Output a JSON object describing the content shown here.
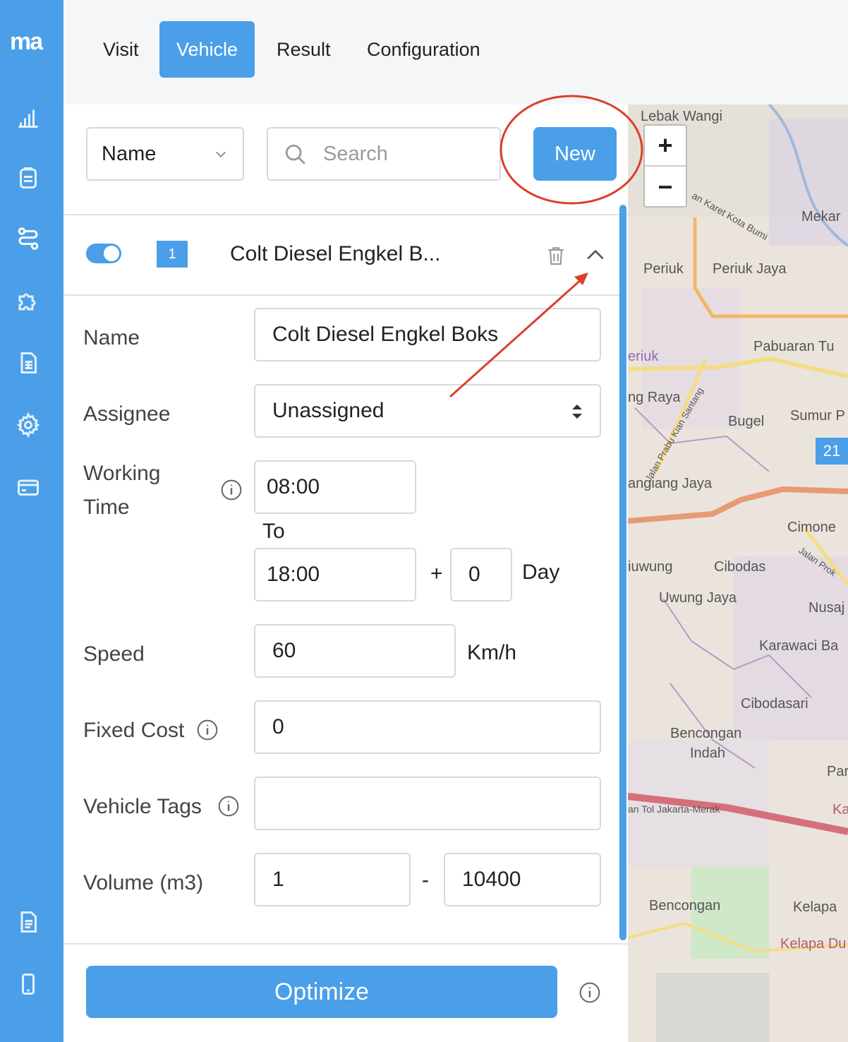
{
  "app": {
    "logo": "ma"
  },
  "tabs": [
    {
      "label": "Visit"
    },
    {
      "label": "Vehicle"
    },
    {
      "label": "Result"
    },
    {
      "label": "Configuration"
    }
  ],
  "toolbar": {
    "sort_select": "Name",
    "search_placeholder": "Search",
    "new_label": "New"
  },
  "vehicle": {
    "index": "1",
    "title": "Colt Diesel Engkel B...",
    "form": {
      "name_label": "Name",
      "name_value": "Colt Diesel Engkel Boks",
      "assignee_label": "Assignee",
      "assignee_value": "Unassigned",
      "working_time_label_1": "Working",
      "working_time_label_2": "Time",
      "start_time": "08:00",
      "to_label": "To",
      "end_time": "18:00",
      "plus": "+",
      "day_offset": "0",
      "day_label": "Day",
      "speed_label": "Speed",
      "speed_value": "60",
      "speed_unit": "Km/h",
      "fixed_cost_label": "Fixed Cost",
      "fixed_cost_value": "0",
      "tags_label": "Vehicle Tags",
      "tags_value": "",
      "volume_label": "Volume (m3)",
      "volume_min": "1",
      "volume_sep": "-",
      "volume_max": "10400"
    }
  },
  "footer": {
    "optimize_label": "Optimize"
  },
  "map": {
    "zoom_in": "+",
    "zoom_out": "−",
    "cluster_count": "21",
    "labels": [
      "Lebak Wangi",
      "Mekar",
      "Periuk",
      "Periuk Jaya",
      "Pabuaran Tu",
      "eriuk",
      "ng Raya",
      "Bugel",
      "Sumur P",
      "angiang Jaya",
      "Cimone",
      "iuwung",
      "Cibodas",
      "Uwung Jaya",
      "Nusaj",
      "Karawaci Ba",
      "Cibodasari",
      "Bencongan",
      "Indah",
      "Par",
      "Bencongan",
      "Kelapa",
      "Kelapa Du",
      "an Karet Kota Bumi",
      "Jalan Prabu Kian Santang",
      "Jalan Prok",
      "an Tol Jakarta-Merak",
      "Ka"
    ]
  },
  "colors": {
    "accent": "#4a9fe8",
    "annotation": "#d9402b"
  }
}
